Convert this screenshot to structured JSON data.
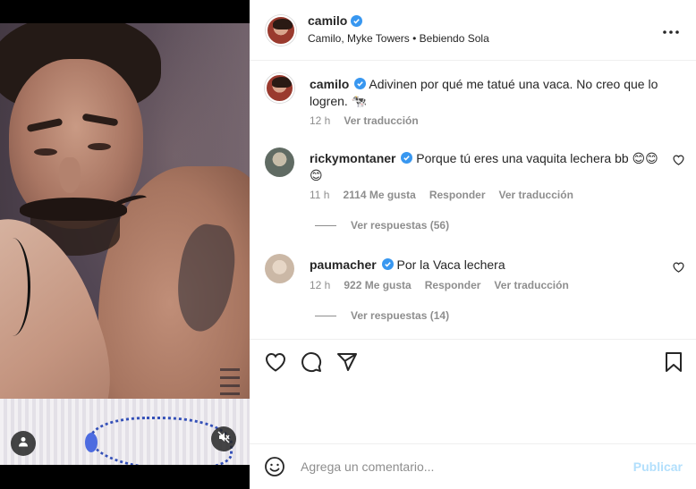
{
  "header": {
    "username": "camilo",
    "subtitle": "Camilo, Myke Towers • Bebiendo Sola",
    "more_icon": "more-horizontal-icon"
  },
  "caption": {
    "username": "camilo",
    "text": "Adivinen por qué me tatué una vaca. No creo que lo logren. 🐄",
    "time": "12 h",
    "translate": "Ver traducción"
  },
  "comments": [
    {
      "username": "rickymontaner",
      "text": "Porque tú eres una vaquita lechera bb 😊😊😊",
      "time": "11 h",
      "likes": "2114 Me gusta",
      "reply": "Responder",
      "translate": "Ver traducción",
      "view_replies": "Ver respuestas (56)"
    },
    {
      "username": "paumacher",
      "text": "Por la Vaca lechera",
      "time": "12 h",
      "likes": "922 Me gusta",
      "reply": "Responder",
      "translate": "Ver traducción",
      "view_replies": "Ver respuestas (14)"
    }
  ],
  "add_comment": {
    "placeholder": "Agrega un comentario...",
    "publish": "Publicar"
  },
  "icons": {
    "verified": "verified-badge-icon",
    "like": "heart-icon",
    "comment": "comment-bubble-icon",
    "share": "paper-plane-icon",
    "save": "bookmark-icon",
    "emoji": "smiley-icon",
    "user_tag": "user-tag-icon",
    "mute": "speaker-muted-icon"
  },
  "colors": {
    "verified_blue": "#3897f0",
    "publish_disabled": "#b2dffc",
    "secondary_text": "#8e8e8e"
  }
}
